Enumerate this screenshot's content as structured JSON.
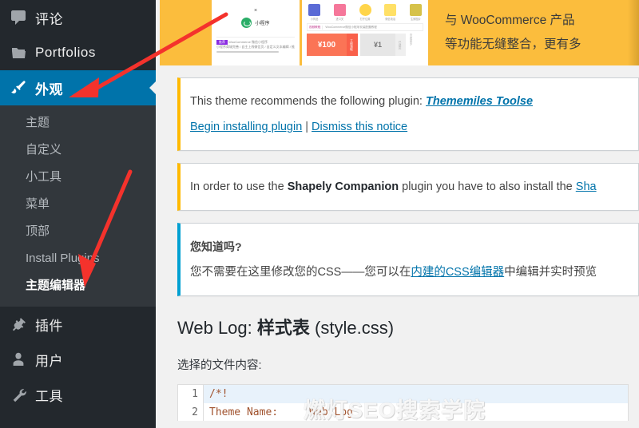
{
  "sidebar": {
    "items": [
      {
        "label": "评论",
        "icon": "comments-icon",
        "type": "top"
      },
      {
        "label": "Portfolios",
        "icon": "portfolio-folder-icon",
        "type": "top"
      },
      {
        "label": "外观",
        "icon": "appearance-brush-icon",
        "type": "top",
        "current": true
      }
    ],
    "submenu": [
      {
        "label": "主题"
      },
      {
        "label": "自定义"
      },
      {
        "label": "小工具"
      },
      {
        "label": "菜单"
      },
      {
        "label": "顶部"
      },
      {
        "label": "Install Plugins"
      },
      {
        "label": "主题编辑器",
        "current": true
      }
    ],
    "items_after": [
      {
        "label": "插件",
        "icon": "plugins-plug-icon"
      },
      {
        "label": "用户",
        "icon": "users-person-icon"
      },
      {
        "label": "工具",
        "icon": "tools-wrench-icon"
      }
    ]
  },
  "promo": {
    "line1": "与 WooCommerce 产品",
    "line2": "等功能无缝整合，更有多",
    "shot_a": {
      "close": "×",
      "brand": "小程序",
      "tag": "推荐",
      "caption": "WooCommerce 微信小程序",
      "sub": "小程序商城完善 / 自主上线微信页 / 自定义文本编辑 / 推"
    },
    "shot_b": {
      "icons": [
        "小商品",
        "进口关",
        "打开位置",
        "微信电话",
        "生鲜图片"
      ],
      "row_tag": "视频教程",
      "row_text": "WooCommerce微信小程序安装配置教程",
      "coupon_red_value": "¥100",
      "coupon_red_side": "立即领取",
      "coupon_gray_value": "¥1",
      "coupon_gray_side": "已领完",
      "more": "查看更多"
    }
  },
  "notices": [
    {
      "id": "tgmpa-notice",
      "type": "warning",
      "line1_prefix": "This theme recommends the following plugin: ",
      "line1_link": "Thememiles Toolse",
      "action_install": "Begin installing plugin",
      "action_sep": "|",
      "action_dismiss": "Dismiss this notice"
    },
    {
      "id": "shapely-companion-notice",
      "type": "warning",
      "text_prefix": "In order to use the ",
      "text_bold": "Shapely Companion",
      "text_mid": " plugin you have to also install the ",
      "text_link": "Sha"
    },
    {
      "id": "css-editor-notice",
      "type": "info",
      "heading": "您知道吗?",
      "body_prefix": "您不需要在这里修改您的CSS——您可以在",
      "body_link": "内建的CSS编辑器",
      "body_suffix": "中编辑并实时预览"
    }
  ],
  "main": {
    "page_title_prefix": "Web Log: ",
    "page_title_bold": "样式表",
    "page_title_suffix": " (style.css)",
    "file_content_label": "选择的文件内容:"
  },
  "editor": {
    "lines": [
      {
        "num": "1",
        "text": "/*!",
        "highlighted": true
      },
      {
        "num": "2",
        "text": "Theme Name:     Web Log",
        "highlighted": false
      }
    ]
  },
  "watermark": "燃灯SEO搜索学院",
  "colors": {
    "sidebar_bg": "#23282d",
    "submenu_bg": "#32373c",
    "accent_blue": "#0073aa",
    "notice_warning": "#ffb900",
    "notice_info": "#00a0d2",
    "promo_yellow": "#fbbd3d",
    "annotation_red": "#f4322c",
    "code_text": "#a0522d"
  }
}
